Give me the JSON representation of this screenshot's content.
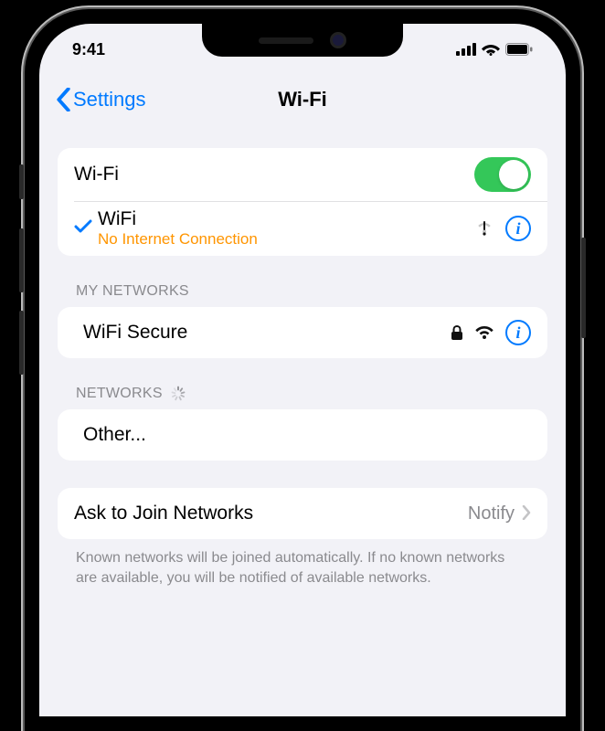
{
  "status_bar": {
    "time": "9:41"
  },
  "nav": {
    "back_label": "Settings",
    "title": "Wi-Fi"
  },
  "wifi_toggle": {
    "label": "Wi-Fi",
    "on": true
  },
  "connected": {
    "name": "WiFi",
    "status": "No Internet Connection"
  },
  "my_networks": {
    "header": "MY NETWORKS",
    "items": [
      {
        "name": "WiFi Secure",
        "locked": true
      }
    ]
  },
  "networks": {
    "header": "NETWORKS",
    "other_label": "Other..."
  },
  "ask_to_join": {
    "label": "Ask to Join Networks",
    "value": "Notify",
    "footer": "Known networks will be joined automatically. If no known networks are available, you will be notified of available networks."
  }
}
